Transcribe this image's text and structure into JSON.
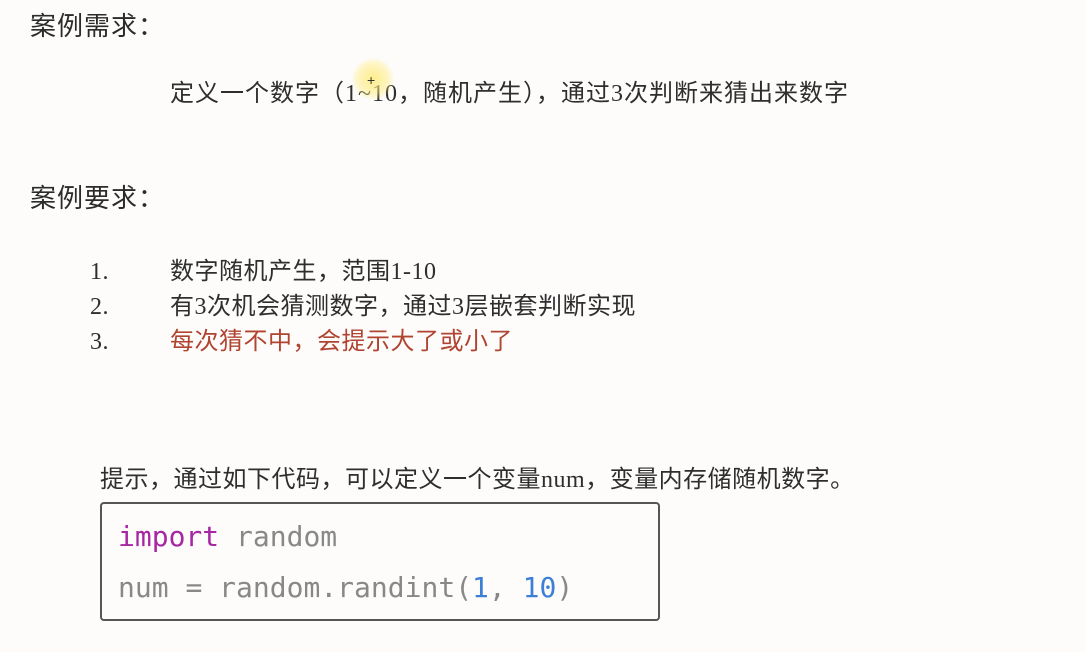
{
  "section1": {
    "title": "案例需求：",
    "description": "定义一个数字（1~10，随机产生），通过3次判断来猜出来数字"
  },
  "section2": {
    "title": "案例要求：",
    "items": [
      {
        "num": "1.",
        "text": "数字随机产生，范围1-10",
        "highlight": false
      },
      {
        "num": "2.",
        "text": "有3次机会猜测数字，通过3层嵌套判断实现",
        "highlight": false
      },
      {
        "num": "3.",
        "text": "每次猜不中，会提示大了或小了",
        "highlight": true
      }
    ]
  },
  "hint": "提示，通过如下代码，可以定义一个变量num，变量内存储随机数字。",
  "code": {
    "line1": {
      "kw": "import",
      "mod": "random"
    },
    "line2": {
      "var": "num",
      "eq": "=",
      "obj": "random",
      "dot": ".",
      "fn": "randint",
      "lp": "(",
      "n1": "1",
      "cm": ",",
      "sp": " ",
      "n2": "10",
      "rp": ")"
    }
  }
}
